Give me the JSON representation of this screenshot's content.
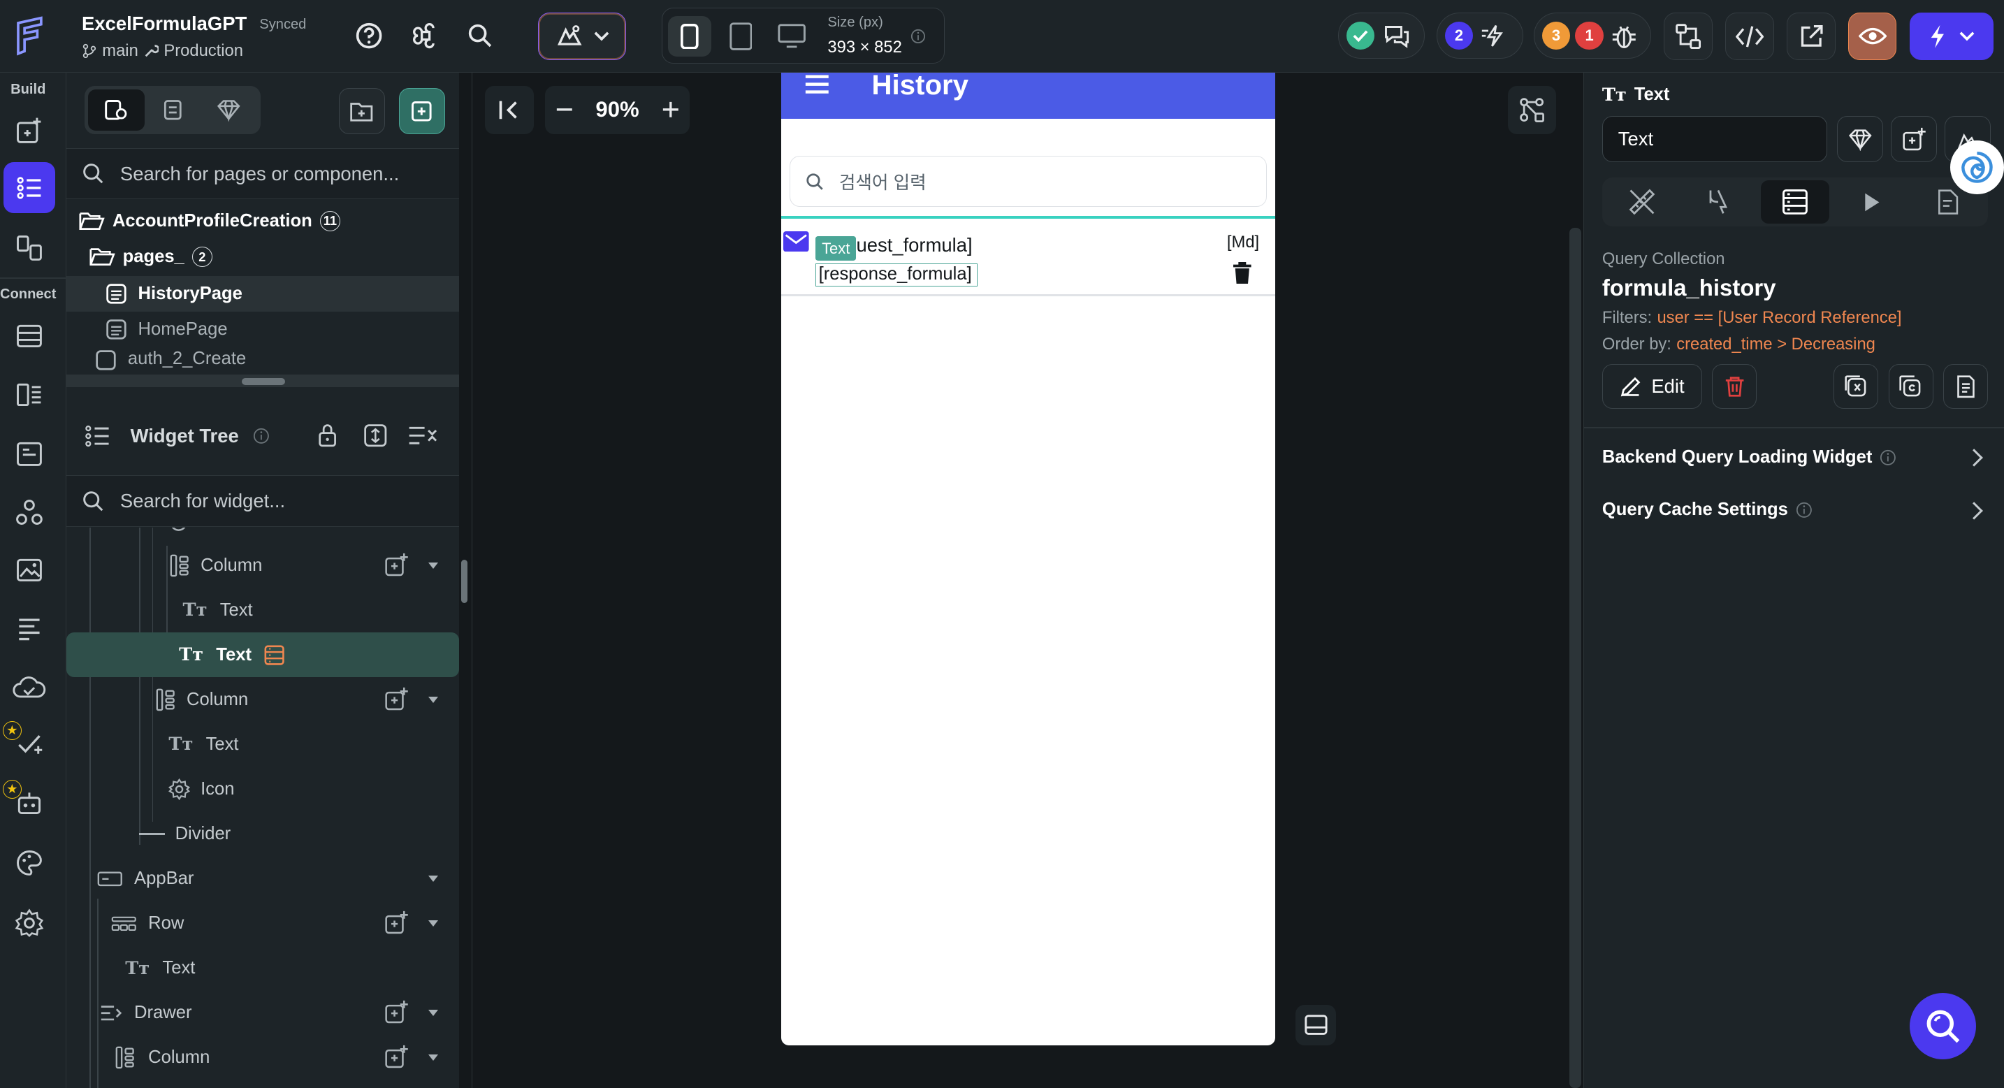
{
  "app": {
    "project_name": "ExcelFormulaGPT",
    "sync_status": "Synced",
    "branch": "main",
    "environment": "Production"
  },
  "toolbar": {
    "size_label": "Size (px)",
    "size_value": "393 × 852",
    "collab_count": "2",
    "warning_count": "3",
    "error_count": "1"
  },
  "rail": {
    "build_label": "Build",
    "connect_label": "Connect"
  },
  "pages_panel": {
    "search_placeholder": "Search for pages or componen...",
    "items": [
      {
        "label": "AccountProfileCreation",
        "count": "11"
      },
      {
        "label": "pages_",
        "count": "2"
      },
      {
        "label": "HistoryPage"
      },
      {
        "label": "HomePage"
      },
      {
        "label": "auth_2_Create"
      }
    ]
  },
  "widget_tree": {
    "title": "Widget Tree",
    "search_placeholder": "Search for widget...",
    "rows": [
      {
        "label": "Column"
      },
      {
        "label": "Text"
      },
      {
        "label": "Text"
      },
      {
        "label": "Column"
      },
      {
        "label": "Text"
      },
      {
        "label": "Icon"
      },
      {
        "label": "Divider"
      },
      {
        "label": "AppBar"
      },
      {
        "label": "Row"
      },
      {
        "label": "Text"
      },
      {
        "label": "Drawer"
      },
      {
        "label": "Column"
      }
    ]
  },
  "canvas": {
    "zoom": "90%"
  },
  "phone": {
    "appbar_title": "History",
    "search_placeholder": "검색어 입력",
    "item_tag": "Text",
    "request_text": "uest_formula]",
    "response_text": "[response_formula]",
    "date_text": "[Md]"
  },
  "properties": {
    "widget_type": "Text",
    "widget_name": "Text",
    "query_collection_label": "Query Collection",
    "collection_name": "formula_history",
    "filters_label": "Filters:",
    "filters_value": "user == [User Record Reference]",
    "order_label": "Order by:",
    "order_value": "created_time > Decreasing",
    "edit_label": "Edit",
    "section_loading": "Backend Query Loading Widget",
    "section_cache": "Query Cache Settings"
  }
}
